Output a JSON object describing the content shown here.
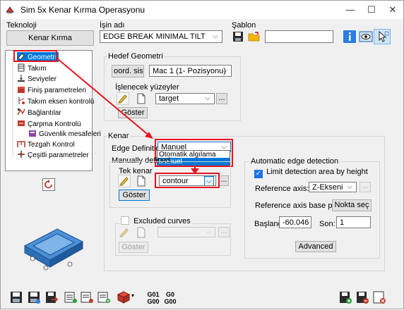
{
  "window": {
    "title": "Sim 5x Kenar Kırma Operasyonu"
  },
  "teknoloji": {
    "label": "Teknoloji",
    "button": "Kenar Kırma"
  },
  "isin_adi": {
    "label": "İşin adı",
    "value": "EDGE BREAK MINIMAL TILT"
  },
  "sablon": {
    "label": "Şablon",
    "value": ""
  },
  "tree": {
    "items": [
      {
        "label": "Geometri",
        "icon": "eraser-icon"
      },
      {
        "label": "Takım",
        "icon": "tool-icon"
      },
      {
        "label": "Seviyeler",
        "icon": "levels-icon"
      },
      {
        "label": "Finiş parametreleri",
        "icon": "finish-icon"
      },
      {
        "label": "Takım eksen kontrolü",
        "icon": "tool-axis-icon"
      },
      {
        "label": "Bağlantılar",
        "icon": "links-icon"
      },
      {
        "label": "Çarpma Kontrolü",
        "icon": "collision-icon"
      },
      {
        "label": "Güvenlik mesafeleri",
        "icon": "clearance-icon"
      },
      {
        "label": "Tezgah Kontrol",
        "icon": "machine-icon"
      },
      {
        "label": "Çeşitli parametreler",
        "icon": "misc-icon"
      }
    ]
  },
  "hedef_geometri": {
    "title": "Hedef Geometri",
    "coord_button": "oord. sisterr",
    "coord_value": "Mac 1 (1- Pozisyonu)",
    "islenecek_label": "İşlenecek yüzeyler",
    "target_value": "target",
    "more_button": "...",
    "goster_button": "Göster"
  },
  "kenar": {
    "title": "Kenar",
    "edge_definition_label": "Edge Definition",
    "edge_definition_value": "Manuel",
    "dropdown_options": [
      "Otomatik algılama",
      "Manuel"
    ],
    "manually_defined_label": "Manually defined",
    "tek_kenar_label": "Tek kenar",
    "contour_value": "contour",
    "more_button": "...",
    "goster_button": "Göster",
    "excluded_curves_label": "Excluded curves",
    "excluded_more_button": "...",
    "excluded_goster_button": "Göster"
  },
  "auto_edge": {
    "title": "Automatic edge detection",
    "limit_label": "Limit detection area by height",
    "reference_axis_label": "Reference axis:",
    "reference_axis_value": "Z-Ekseni",
    "more_button": "...",
    "base_point_label": "Reference axis base point",
    "nokta_sec_button": "Nokta seç",
    "baslangic_label": "Başlangıç:",
    "baslangic_value": "-60.046",
    "son_label": "Son:",
    "son_value": "1",
    "advanced_button": "Advanced"
  },
  "toolbar": {
    "g01_label": "G01",
    "g00_label": "G00",
    "g00b_label": "G0",
    "g00c_label": "G00"
  },
  "colors": {
    "highlight_red": "#e8141e",
    "selection_blue": "#0078d7",
    "accent_blue": "#1a73e8"
  }
}
